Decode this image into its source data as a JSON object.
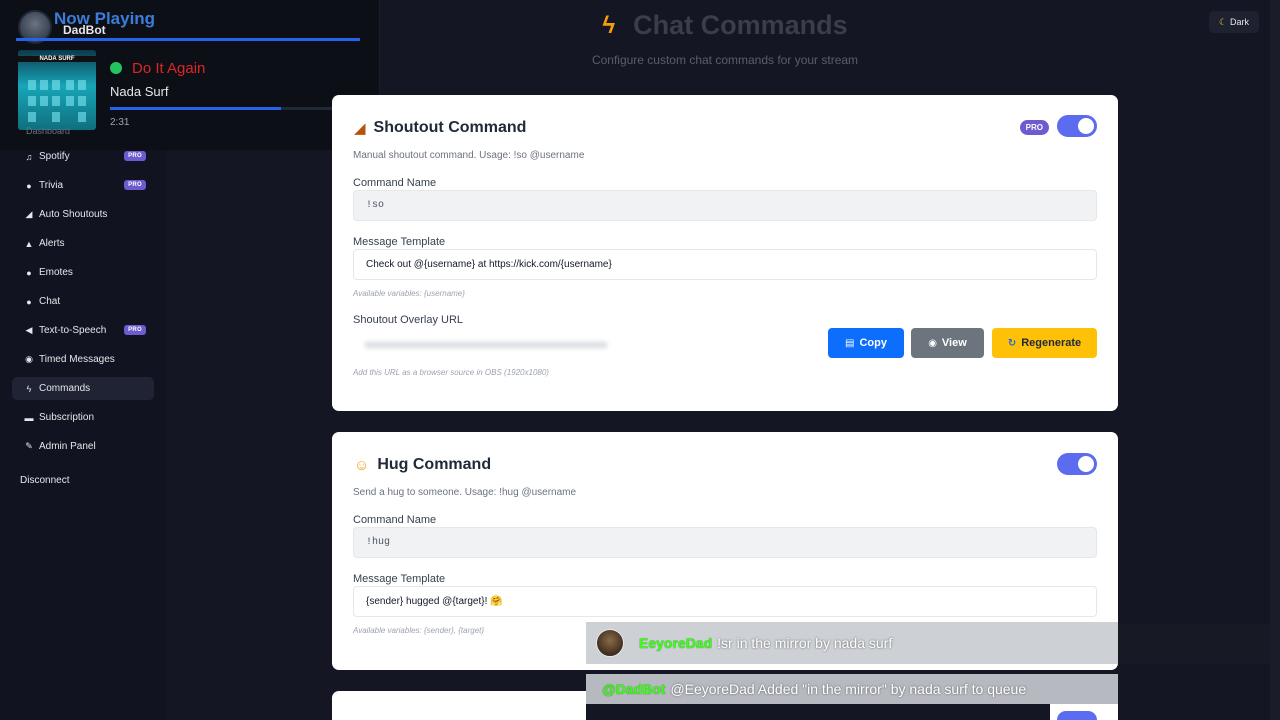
{
  "header": {
    "title": "Chat Commands",
    "subtitle": "Configure custom chat commands for your stream",
    "theme_label": "Dark"
  },
  "now_playing": {
    "title": "Now Playing",
    "bot_name": "DadBot",
    "song": "Do It Again",
    "artist": "Nada Surf",
    "elapsed": "2:31",
    "progress": 0.76,
    "album_label": "NADA SURF",
    "dashboard_ghost": "Dashboard"
  },
  "sidebar": {
    "items": [
      {
        "label": "Spotify",
        "icon": "music-note-icon",
        "glyph": "♫",
        "pro": true,
        "active": false
      },
      {
        "label": "Trivia",
        "icon": "brain-icon",
        "glyph": "●",
        "pro": true,
        "active": false
      },
      {
        "label": "Auto Shoutouts",
        "icon": "megaphone-icon",
        "glyph": "◢",
        "pro": false,
        "active": false
      },
      {
        "label": "Alerts",
        "icon": "bell-icon",
        "glyph": "▲",
        "pro": false,
        "active": false
      },
      {
        "label": "Emotes",
        "icon": "smiley-icon",
        "glyph": "●",
        "pro": false,
        "active": false
      },
      {
        "label": "Chat",
        "icon": "speech-bubble-icon",
        "glyph": "●",
        "pro": false,
        "active": false
      },
      {
        "label": "Text-to-Speech",
        "icon": "speaker-icon",
        "glyph": "◀",
        "pro": true,
        "active": false
      },
      {
        "label": "Timed Messages",
        "icon": "alarm-clock-icon",
        "glyph": "◉",
        "pro": false,
        "active": false
      },
      {
        "label": "Commands",
        "icon": "lightning-icon",
        "glyph": "ϟ",
        "pro": false,
        "active": true
      },
      {
        "label": "Subscription",
        "icon": "credit-card-icon",
        "glyph": "▬",
        "pro": false,
        "active": false
      },
      {
        "label": "Admin Panel",
        "icon": "wrench-icon",
        "glyph": "✎",
        "pro": false,
        "active": false
      }
    ],
    "pro_label": "PRO",
    "disconnect": "Disconnect"
  },
  "shoutout": {
    "title": "Shoutout Command",
    "pro_label": "PRO",
    "enabled": true,
    "description": "Manual shoutout command. Usage: !so @username",
    "name_label": "Command Name",
    "name_value": "!so",
    "template_label": "Message Template",
    "template_value": "Check out @{username} at https://kick.com/{username}",
    "variables": "Available variables: {username}",
    "url_label": "Shoutout Overlay URL",
    "url_hint": "Add this URL as a browser source in OBS (1920x1080)",
    "copy": "Copy",
    "view": "View",
    "regenerate": "Regenerate"
  },
  "hug": {
    "title": "Hug Command",
    "enabled": true,
    "description": "Send a hug to someone. Usage: !hug @username",
    "name_label": "Command Name",
    "name_value": "!hug",
    "template_label": "Message Template",
    "template_value": "{sender} hugged @{target}! 🤗",
    "variables": "Available variables: {sender}, {target}"
  },
  "chat_overlay": {
    "msg1_user": "EeyoreDad",
    "msg1_text": "!sr in the mirror by nada surf",
    "msg2_user": "@DadBot",
    "msg2_text": "@EeyoreDad Added \"in the mirror\" by nada surf to queue"
  }
}
